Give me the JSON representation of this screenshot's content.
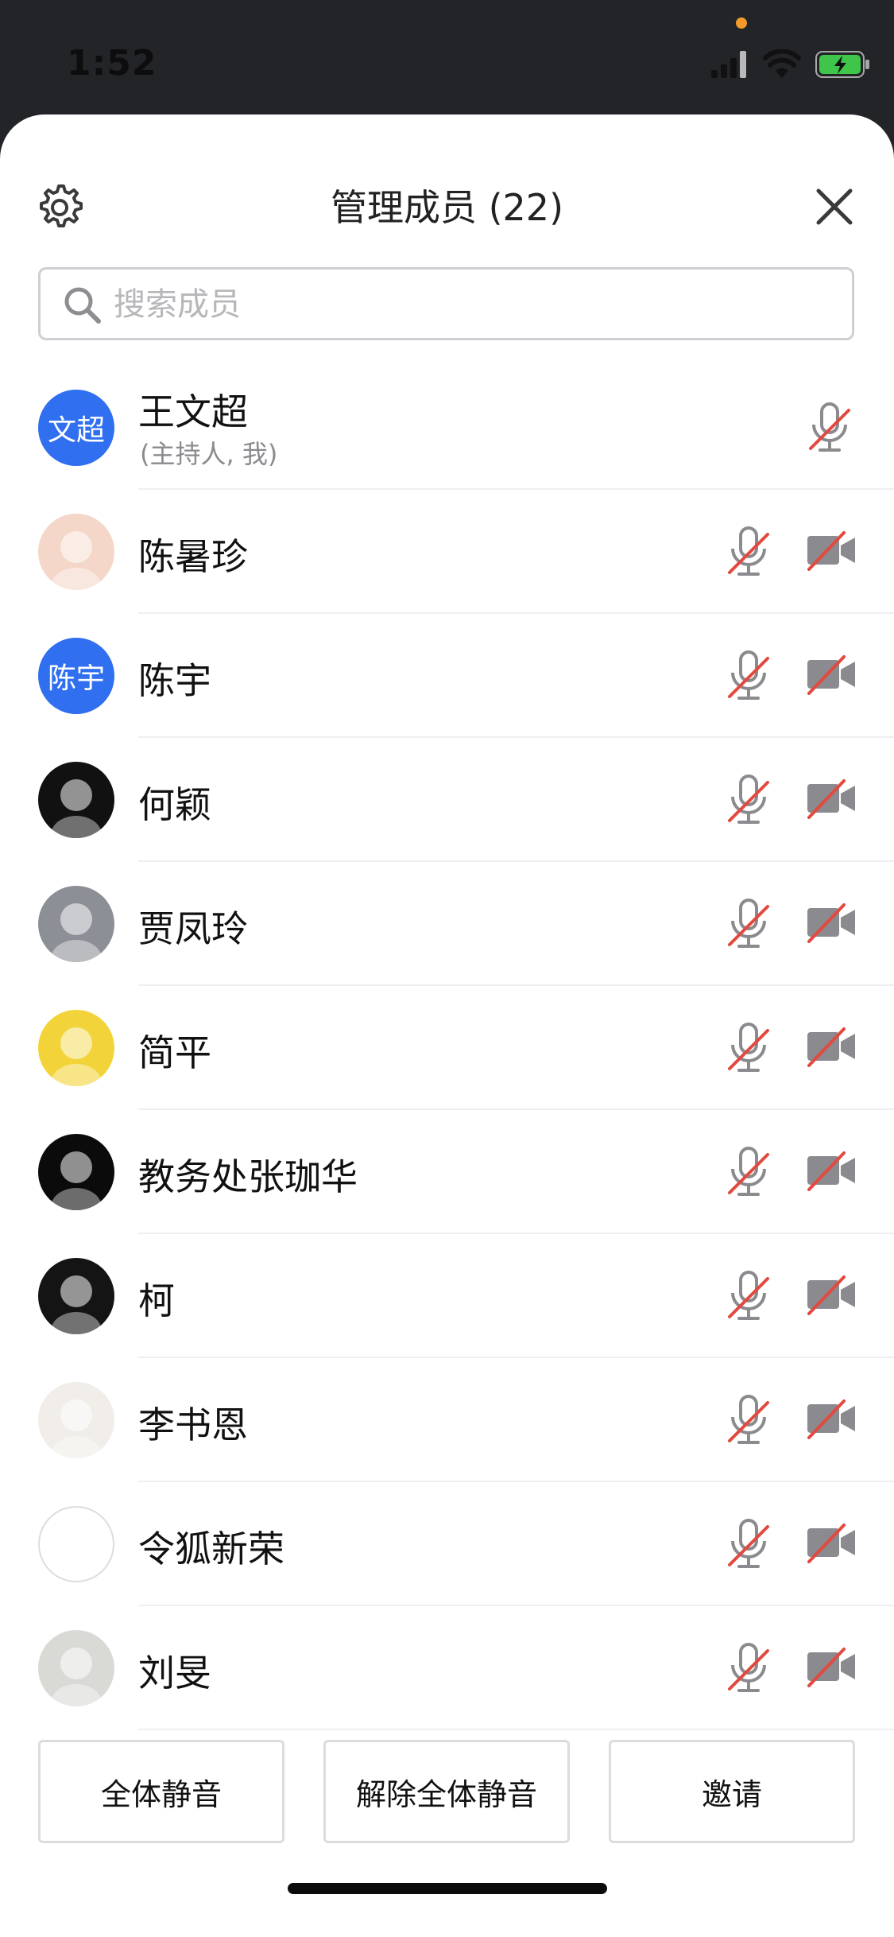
{
  "status_bar": {
    "time": "1:52"
  },
  "header": {
    "title": "管理成员 (22)"
  },
  "search": {
    "placeholder": "搜索成员"
  },
  "members": [
    {
      "name": "王文超",
      "role": "(主持人, 我)",
      "avatar_text": "文超",
      "avatar_type": "initials",
      "show_camera": false
    },
    {
      "name": "陈暑珍",
      "avatar_type": "photo",
      "avatar_icon": "girl-glasses-avatar",
      "avatar_color": "#f4d7c8",
      "show_camera": true
    },
    {
      "name": "陈宇",
      "avatar_text": "陈宇",
      "avatar_type": "initials",
      "show_camera": true
    },
    {
      "name": "何颖",
      "avatar_type": "photo",
      "avatar_icon": "kitten-avatar",
      "avatar_color": "#111111",
      "show_camera": true
    },
    {
      "name": "贾凤玲",
      "avatar_type": "photo",
      "avatar_icon": "landscape-avatar",
      "avatar_color": "#8c8f96",
      "show_camera": true
    },
    {
      "name": "简平",
      "avatar_type": "photo",
      "avatar_icon": "cartoon-boy-avatar",
      "avatar_color": "#f2d43a",
      "show_camera": true
    },
    {
      "name": "教务处张珈华",
      "avatar_type": "photo",
      "avatar_icon": "monster-grin-avatar",
      "avatar_color": "#0b0b0b",
      "show_camera": true
    },
    {
      "name": "柯",
      "avatar_type": "photo",
      "avatar_icon": "top-hat-avatar",
      "avatar_color": "#141414",
      "show_camera": true
    },
    {
      "name": "李书恩",
      "avatar_type": "photo",
      "avatar_icon": "girl-portrait-avatar",
      "avatar_color": "#f1ede8",
      "show_camera": true
    },
    {
      "name": "令狐新荣",
      "avatar_type": "photo",
      "avatar_icon": "sketch-avatar",
      "avatar_color": "#ffffff",
      "show_camera": true
    },
    {
      "name": "刘旻",
      "avatar_type": "photo",
      "avatar_icon": "eagle-avatar",
      "avatar_color": "#d9d9d6",
      "show_camera": true
    }
  ],
  "footer": {
    "mute_all_label": "全体静音",
    "unmute_all_label": "解除全体静音",
    "invite_label": "邀请"
  },
  "colors": {
    "accent": "#2f6ff0",
    "muted_slash": "#e2493f",
    "icon_gray": "#8a8a8f"
  }
}
